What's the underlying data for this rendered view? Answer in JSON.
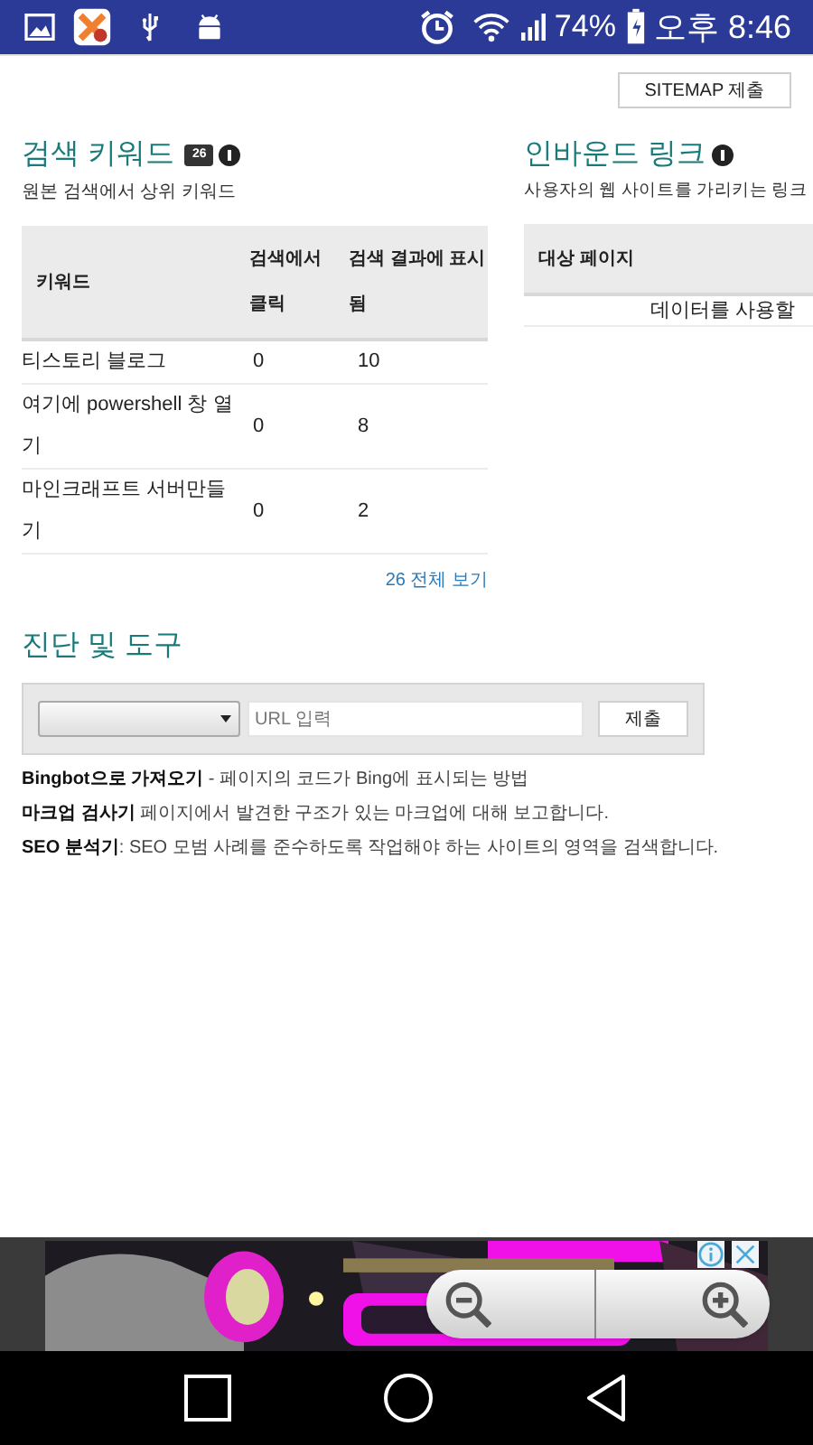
{
  "status_bar": {
    "battery": "74%",
    "time": "오후 8:46"
  },
  "sitemap_button": "SITEMAP 제출",
  "keywords": {
    "title": "검색 키워드",
    "count": "26",
    "subtitle": "원본 검색에서 상위 키워드",
    "columns": [
      "키워드",
      "검색에서 클릭",
      "검색 결과에 표시됨"
    ],
    "rows": [
      [
        "티스토리 블로그",
        "0",
        "10"
      ],
      [
        "여기에 powershell 창 열기",
        "0",
        "8"
      ],
      [
        "마인크래프트 서버만들기",
        "0",
        "2"
      ]
    ],
    "view_all": "26 전체 보기"
  },
  "inbound": {
    "title": "인바운드 링크",
    "subtitle": "사용자의 웹 사이트를 가리키는 링크",
    "columns": [
      "대상 페이지"
    ],
    "empty": "데이터를 사용할"
  },
  "tools": {
    "title": "진단 및 도구",
    "url_placeholder": "URL 입력",
    "submit": "제출",
    "items": [
      "**Bingbot으로 가져오기** - 페이지의 코드가 Bing에 표시되는 방법",
      "**마크업 검사기** 페이지에서 발견한 구조가 있는 마크업에 대해 보고합니다.",
      "**SEO 분석기**: SEO 모범 사례를 준수하도록 작업해야 하는 사이트의 영역을 검색합니다."
    ]
  }
}
